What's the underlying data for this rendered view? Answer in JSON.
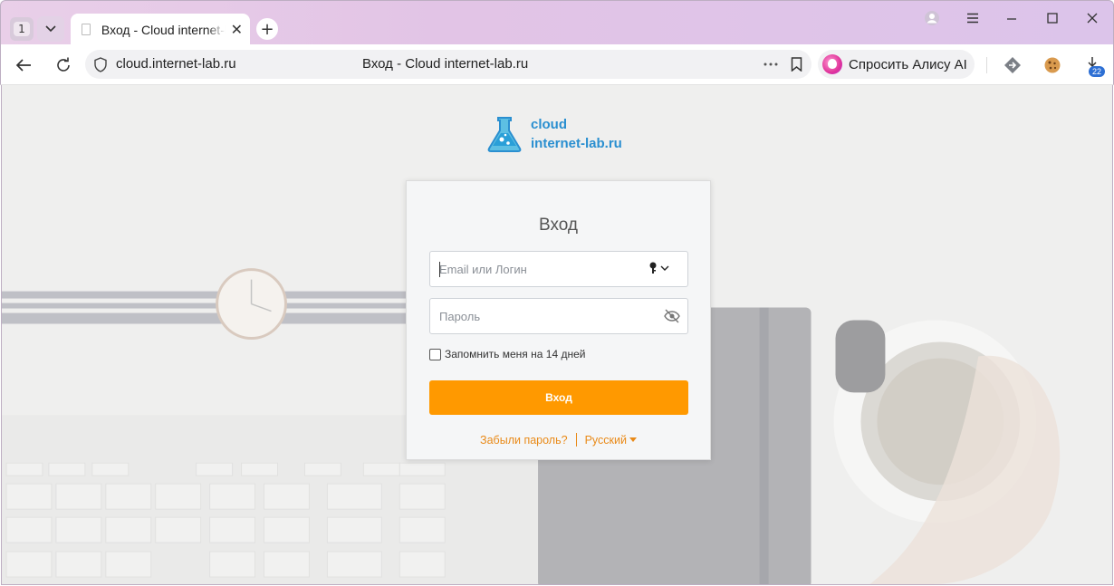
{
  "browser": {
    "tab_count": "1",
    "tab_title": "Вход - Cloud internet-lab.ru",
    "url": "cloud.internet-lab.ru",
    "page_title": "Вход - Cloud internet-lab.ru",
    "alice_label": "Спросить Алису AI",
    "downloads_badge": "22"
  },
  "page": {
    "logo_line1": "cloud",
    "logo_line2": "internet-lab.ru",
    "login_title": "Вход",
    "username_placeholder": "Email или Логин",
    "password_placeholder": "Пароль",
    "remember_label": "Запомнить меня на 14 дней",
    "remember_checked": false,
    "login_button": "Вход",
    "forgot_link": "Забыли пароль?",
    "language": "Русский",
    "accent_color": "#ff9900",
    "logo_color": "#2a8fd0"
  }
}
